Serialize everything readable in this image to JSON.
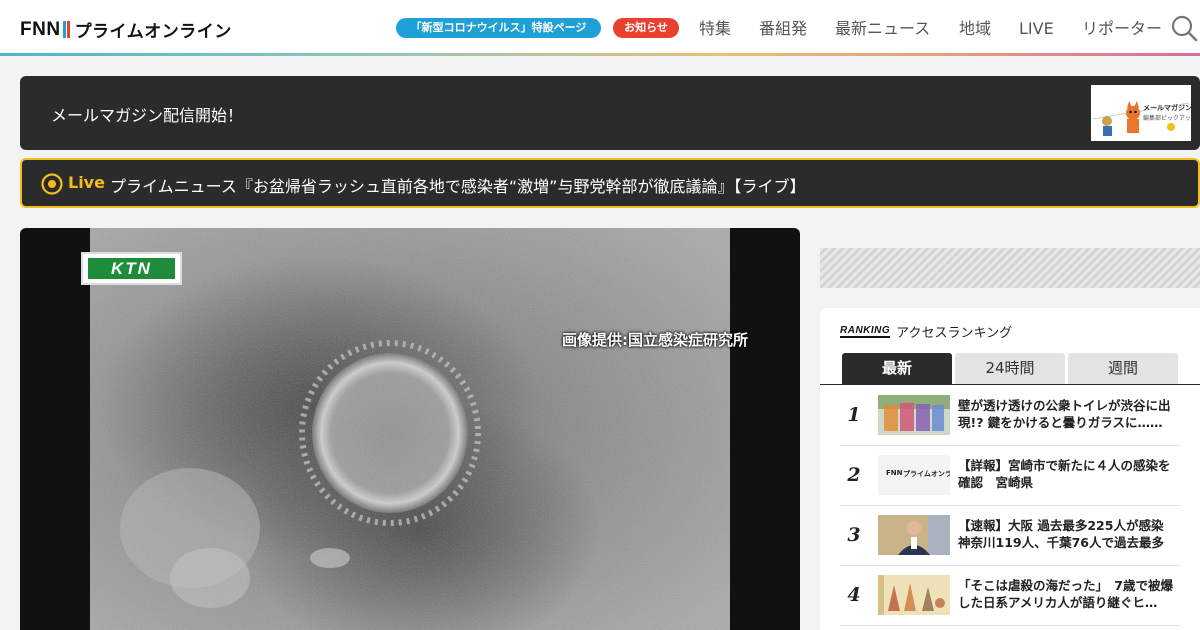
{
  "header": {
    "logo_mark": "FNN",
    "logo_text": "プライムオンライン",
    "corona_pill": "「新型コロナウイルス」特設ページ",
    "notice_pill": "お知らせ",
    "nav": [
      "特集",
      "番組発",
      "最新ニュース",
      "地域",
      "LIVE",
      "リポーター"
    ],
    "search_icon": "search-icon",
    "colors": {
      "corona": "#1fa0d6",
      "notice": "#e9412e",
      "logo_bar_1": "#1fa0d6",
      "logo_bar_2": "#e9412e"
    }
  },
  "banner": {
    "text": "メールマガジン配信開始！",
    "thumb_title": "メールマガジン",
    "thumb_sub": "編集部ピックアップ"
  },
  "live": {
    "label": "Live",
    "title": "プライムニュース『お盆帰省ラッシュ直前各地で感染者“激増”与野党幹部が徹底議論』【ライブ】",
    "accent": "#f2bd1d"
  },
  "hero": {
    "station_logo": "KTN",
    "credit": "画像提供:国立感染症研究所"
  },
  "ranking": {
    "title_en": "RANKING",
    "title_jp": "アクセスランキング",
    "tabs": [
      "最新",
      "24時間",
      "週間"
    ],
    "active_tab": "最新",
    "items": [
      {
        "rank": "1",
        "title": "壁が透け透けの公衆トイレが渋谷に出現!? 鍵をかけると曇りガラスに……",
        "thumb": "colored-toilets"
      },
      {
        "rank": "2",
        "title": "【詳報】宮崎市で新たに４人の感染を確認　宮崎県",
        "thumb": "fnn-logo"
      },
      {
        "rank": "3",
        "title": "【速報】大阪 過去最多225人が感染 神奈川119人、千葉76人で過去最多",
        "thumb": "person"
      },
      {
        "rank": "4",
        "title": "「そこは虐殺の海だった」　7歳で被爆した日系アメリカ人が語り継ぐヒ…",
        "thumb": "drawing"
      }
    ]
  }
}
